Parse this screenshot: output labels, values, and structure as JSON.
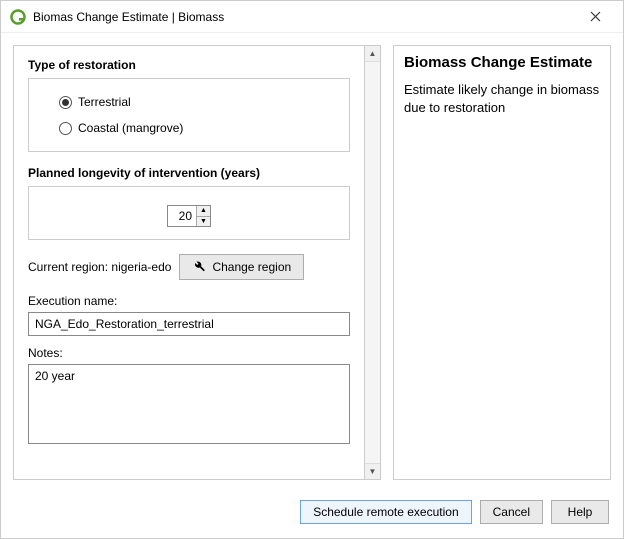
{
  "window": {
    "title": "Biomas Change Estimate | Biomass"
  },
  "left": {
    "restoration": {
      "group_title": "Type of restoration",
      "options": {
        "terrestrial": "Terrestrial",
        "coastal": "Coastal (mangrove)"
      },
      "selected": "terrestrial"
    },
    "longevity": {
      "group_title": "Planned longevity of intervention (years)",
      "value": "20"
    },
    "region": {
      "label_prefix": "Current region:",
      "value": "nigeria-edo",
      "button": "Change region"
    },
    "execution": {
      "label": "Execution name:",
      "value": "NGA_Edo_Restoration_terrestrial"
    },
    "notes": {
      "label": "Notes:",
      "value": "20 year"
    }
  },
  "right": {
    "heading": "Biomass Change Estimate",
    "text": "Estimate likely change in biomass due to restoration"
  },
  "footer": {
    "schedule": "Schedule remote execution",
    "cancel": "Cancel",
    "help": "Help"
  }
}
